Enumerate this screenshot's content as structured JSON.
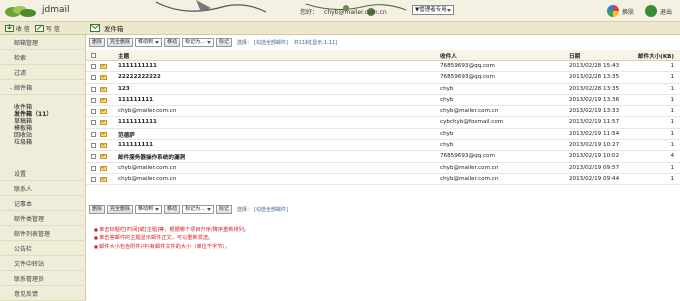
{
  "header": {
    "brand": "jdmail",
    "greeting": "您好：",
    "user_email": "chyb@mailer.com.cn",
    "role_select": "▼管理者专用",
    "skin_label": "换肤",
    "logout_label": "退出"
  },
  "toolbar": {
    "receive_label": "收 信",
    "compose_label": "写 信",
    "folder_title": "发件箱"
  },
  "sidebar": {
    "items": {
      "mail_mgmt": "邮箱管理",
      "search": "检索",
      "filter": "过滤",
      "mailbox": "- 邮件箱",
      "settings": "设置",
      "contacts": "联系人",
      "notes": "记事本",
      "mail_class_mgmt": "邮件类管理",
      "mail_list_mgmt": "邮件列表管理",
      "bulletin": "公告栏",
      "file_transfer": "文件中转站",
      "contact_admin": "联系管理员",
      "feedback": "意见反馈"
    },
    "folders": {
      "inbox": "收件箱",
      "outbox": "发件箱（11）",
      "drafts": "草稿箱",
      "templates": "模板箱",
      "recycle": "回收站",
      "spam": "垃圾箱"
    }
  },
  "actions": {
    "delete": "删除",
    "perm_delete": "完全删除",
    "move_to": "移动到",
    "move": "移动",
    "mark_as": "标记为...",
    "mark": "标记",
    "select_label": "选择：",
    "select_all_link": "[勾选全部邮件]",
    "count_text": "共11封[显示:1-11]"
  },
  "columns": {
    "subject": "主题",
    "recipient": "收件人",
    "date": "日期",
    "size": "邮件大小(KB)"
  },
  "rows": [
    {
      "subject": "1111111111",
      "recipient": "76859693@qq.com",
      "date": "2013/02/28 15:43",
      "size": "1",
      "bold": true
    },
    {
      "subject": "22222222222",
      "recipient": "76859693@qq.com",
      "date": "2013/02/28 13:35",
      "size": "1",
      "bold": true
    },
    {
      "subject": "123",
      "recipient": "chyb",
      "date": "2013/02/28 13:35",
      "size": "1",
      "bold": true
    },
    {
      "subject": "111111111",
      "recipient": "chyb",
      "date": "2013/02/19 13:36",
      "size": "1",
      "bold": true
    },
    {
      "subject": "chyb@mailer.com.cn",
      "recipient": "chyb@mailer.com.cn",
      "date": "2013/02/19 13:33",
      "size": "1",
      "bold": false
    },
    {
      "subject": "1111111111",
      "recipient": "cybchyb@foxmail.com",
      "date": "2013/02/19 11:57",
      "size": "1",
      "bold": true
    },
    {
      "subject": "范德萨",
      "recipient": "chyb",
      "date": "2013/02/19 11:54",
      "size": "1",
      "bold": true
    },
    {
      "subject": "111111111",
      "recipient": "chyb",
      "date": "2013/02/19 10:27",
      "size": "1",
      "bold": true
    },
    {
      "subject": "邮件服务器操作系统的漏洞",
      "recipient": "76859693@qq.com",
      "date": "2013/02/19 10:02",
      "size": "4",
      "bold": true
    },
    {
      "subject": "chyb@mailer.com.cn",
      "recipient": "chyb@mailer.com.cn",
      "date": "2013/02/19 09:57",
      "size": "1",
      "bold": false
    },
    {
      "subject": "chyb@mailer.com.cn",
      "recipient": "chyb@mailer.com.cn",
      "date": "2013/02/19 09:44",
      "size": "1",
      "bold": false
    }
  ],
  "notes": [
    "单击标题栏[时间]或[主题]等，根据哪个项目升序/降序重新排列。",
    "单击答邮件的主题显示邮件正文，可以重新发送。",
    "邮件大小包含附件(中)有邮件文件的大小（单位千字节）。"
  ]
}
